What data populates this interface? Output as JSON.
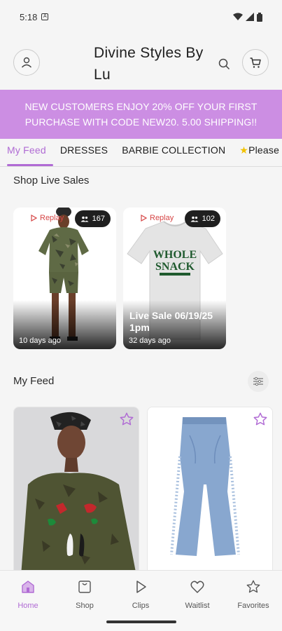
{
  "status": {
    "time": "5:18"
  },
  "header": {
    "title": "Divine Styles By Lu"
  },
  "promo": {
    "text": "NEW CUSTOMERS ENJOY 20% OFF YOUR FIRST PURCHASE WITH CODE NEW20. 5.00 SHIPPING!!"
  },
  "tabs": [
    {
      "label": "My Feed"
    },
    {
      "label": "DRESSES"
    },
    {
      "label": "BARBIE COLLECTION"
    },
    {
      "label": "Please"
    }
  ],
  "live_section": {
    "title": "Shop Live Sales"
  },
  "live_cards": [
    {
      "replay": "Replay",
      "viewers": "167",
      "title": "",
      "ago": "10 days ago"
    },
    {
      "replay": "Replay",
      "viewers": "102",
      "title": "Live Sale 06/19/25 1pm",
      "ago": "32 days ago",
      "shirt_text_1": "WHOLE",
      "shirt_text_2": "SNACK"
    }
  ],
  "feed_section": {
    "title": "My Feed"
  },
  "bottom_nav": [
    {
      "label": "Home",
      "icon": "home-icon"
    },
    {
      "label": "Shop",
      "icon": "shop-icon"
    },
    {
      "label": "Clips",
      "icon": "play-icon"
    },
    {
      "label": "Waitlist",
      "icon": "heart-icon"
    },
    {
      "label": "Favorites",
      "icon": "star-icon"
    }
  ],
  "colors": {
    "accent": "#b06bd4",
    "promo_bg": "#cc8ee3"
  }
}
